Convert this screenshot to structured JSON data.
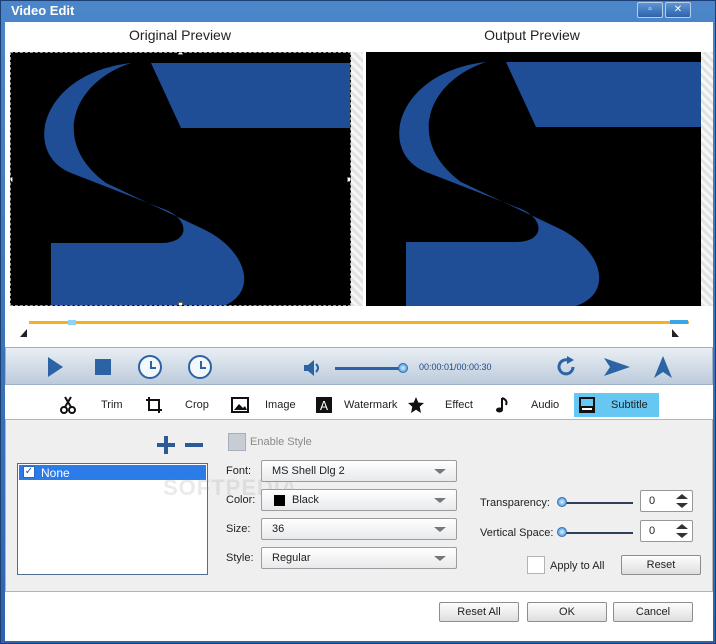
{
  "window": {
    "title": "Video Edit",
    "maximize_icon": "maximize-icon",
    "close_icon": "close-icon"
  },
  "preview": {
    "original_label": "Original Preview",
    "output_label": "Output Preview"
  },
  "playback": {
    "time": "00:00:01/00:00:30",
    "volume_fraction": 0.95,
    "timeline_fraction": 0.0
  },
  "tabs": [
    {
      "label": "Trim",
      "icon": "scissors-icon"
    },
    {
      "label": "Crop",
      "icon": "crop-icon"
    },
    {
      "label": "Image",
      "icon": "image-icon"
    },
    {
      "label": "Watermark",
      "icon": "watermark-icon"
    },
    {
      "label": "Effect",
      "icon": "star-icon"
    },
    {
      "label": "Audio",
      "icon": "music-note-icon"
    },
    {
      "label": "Subtitle",
      "icon": "subtitle-icon",
      "selected": true
    }
  ],
  "subtitle": {
    "list": [
      {
        "label": "None",
        "checked": true,
        "selected": true
      }
    ],
    "enable_style_label": "Enable Style",
    "font_label": "Font:",
    "font_value": "MS Shell Dlg 2",
    "color_label": "Color:",
    "color_value": "Black",
    "color_hex": "#000000",
    "size_label": "Size:",
    "size_value": "36",
    "style_label": "Style:",
    "style_value": "Regular",
    "transparency_label": "Transparency:",
    "transparency_value": "0",
    "vertical_space_label": "Vertical Space:",
    "vertical_space_value": "0",
    "apply_all_label": "Apply to All",
    "reset_label": "Reset"
  },
  "footer": {
    "reset_all": "Reset All",
    "ok": "OK",
    "cancel": "Cancel"
  },
  "watermark": "SOFTPEDIA",
  "colors": {
    "title_bar": "#3a70b5",
    "accent": "#2c63a5",
    "tab_selected": "#66c7f2",
    "timeline": "#f6b11d",
    "list_selected": "#2b7be8"
  }
}
